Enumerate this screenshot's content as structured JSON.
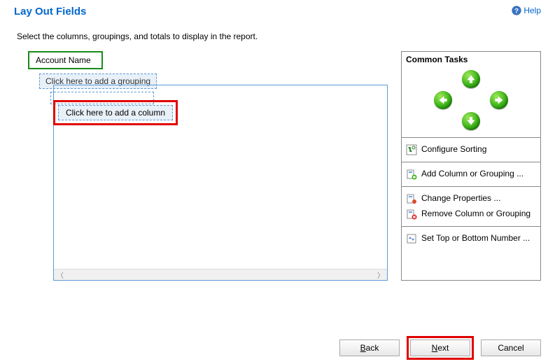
{
  "header": {
    "title": "Lay Out Fields",
    "help_label": "Help"
  },
  "instruction": "Select the columns, groupings, and totals to display in the report.",
  "layout": {
    "account_name": "Account Name",
    "add_grouping": "Click here to add a grouping",
    "add_column": "Click here to add a column"
  },
  "common_tasks": {
    "title": "Common Tasks",
    "configure_sorting": "Configure Sorting",
    "add_column_grouping": "Add Column or Grouping ...",
    "change_properties": "Change Properties ...",
    "remove_column_grouping": "Remove Column or Grouping",
    "set_top_bottom": "Set Top or Bottom Number ..."
  },
  "buttons": {
    "back": "Back",
    "next": "Next",
    "cancel": "Cancel"
  }
}
